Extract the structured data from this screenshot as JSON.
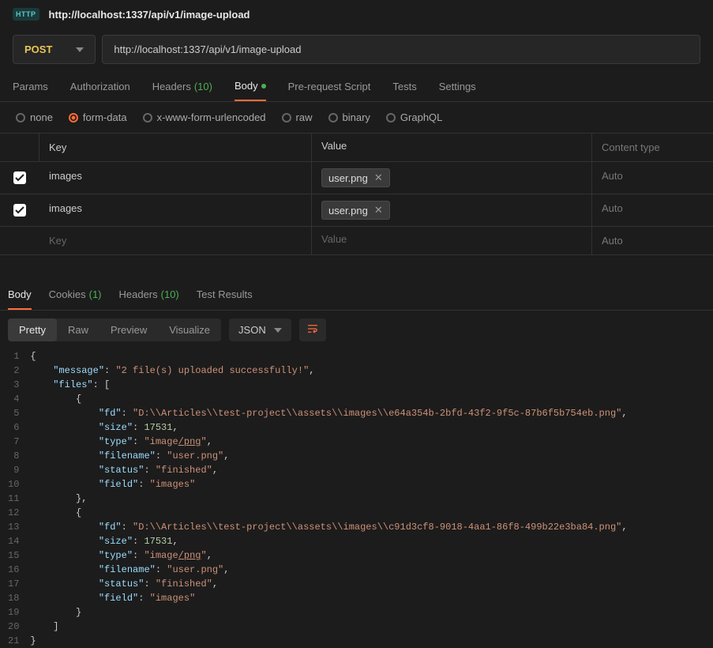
{
  "title": "http://localhost:1337/api/v1/image-upload",
  "badge": "HTTP",
  "method": "POST",
  "url": "http://localhost:1337/api/v1/image-upload",
  "request_tabs": {
    "params": "Params",
    "auth": "Authorization",
    "headers": "Headers",
    "headers_count": "(10)",
    "body": "Body",
    "prerequest": "Pre-request Script",
    "tests": "Tests",
    "settings": "Settings"
  },
  "body_types": {
    "none": "none",
    "formdata": "form-data",
    "urlencoded": "x-www-form-urlencoded",
    "raw": "raw",
    "binary": "binary",
    "graphql": "GraphQL"
  },
  "form_headers": {
    "key": "Key",
    "value": "Value",
    "type": "Content type"
  },
  "form_rows": [
    {
      "key": "images",
      "file": "user.png",
      "type": "Auto"
    },
    {
      "key": "images",
      "file": "user.png",
      "type": "Auto"
    }
  ],
  "placeholders": {
    "key": "Key",
    "value": "Value",
    "type": "Auto"
  },
  "response_tabs": {
    "body": "Body",
    "cookies": "Cookies",
    "cookies_count": "(1)",
    "headers": "Headers",
    "headers_count": "(10)",
    "tests": "Test Results"
  },
  "view_modes": {
    "pretty": "Pretty",
    "raw": "Raw",
    "preview": "Preview",
    "visualize": "Visualize"
  },
  "format": "JSON",
  "json_lines": [
    {
      "n": 1,
      "t": "{",
      "c": "p"
    },
    {
      "n": 2,
      "indent": 2,
      "parts": [
        {
          "t": "\"message\"",
          "c": "k"
        },
        {
          "t": ": ",
          "c": "p"
        },
        {
          "t": "\"2 file(s) uploaded successfully!\"",
          "c": "s"
        },
        {
          "t": ",",
          "c": "p"
        }
      ]
    },
    {
      "n": 3,
      "indent": 2,
      "parts": [
        {
          "t": "\"files\"",
          "c": "k"
        },
        {
          "t": ": [",
          "c": "p"
        }
      ]
    },
    {
      "n": 4,
      "indent": 4,
      "parts": [
        {
          "t": "{",
          "c": "p"
        }
      ]
    },
    {
      "n": 5,
      "indent": 6,
      "parts": [
        {
          "t": "\"fd\"",
          "c": "k"
        },
        {
          "t": ": ",
          "c": "p"
        },
        {
          "t": "\"D:\\\\Articles\\\\test-project\\\\assets\\\\images\\\\e64a354b-2bfd-43f2-9f5c-87b6f5b754eb.png\"",
          "c": "s"
        },
        {
          "t": ",",
          "c": "p"
        }
      ]
    },
    {
      "n": 6,
      "indent": 6,
      "parts": [
        {
          "t": "\"size\"",
          "c": "k"
        },
        {
          "t": ": ",
          "c": "p"
        },
        {
          "t": "17531",
          "c": "n"
        },
        {
          "t": ",",
          "c": "p"
        }
      ]
    },
    {
      "n": 7,
      "indent": 6,
      "parts": [
        {
          "t": "\"type\"",
          "c": "k"
        },
        {
          "t": ": ",
          "c": "p"
        },
        {
          "t": "\"image",
          "c": "s"
        },
        {
          "t": "/png",
          "c": "s u"
        },
        {
          "t": "\"",
          "c": "s"
        },
        {
          "t": ",",
          "c": "p"
        }
      ]
    },
    {
      "n": 8,
      "indent": 6,
      "parts": [
        {
          "t": "\"filename\"",
          "c": "k"
        },
        {
          "t": ": ",
          "c": "p"
        },
        {
          "t": "\"user.png\"",
          "c": "s"
        },
        {
          "t": ",",
          "c": "p"
        }
      ]
    },
    {
      "n": 9,
      "indent": 6,
      "parts": [
        {
          "t": "\"status\"",
          "c": "k"
        },
        {
          "t": ": ",
          "c": "p"
        },
        {
          "t": "\"finished\"",
          "c": "s"
        },
        {
          "t": ",",
          "c": "p"
        }
      ]
    },
    {
      "n": 10,
      "indent": 6,
      "parts": [
        {
          "t": "\"field\"",
          "c": "k"
        },
        {
          "t": ": ",
          "c": "p"
        },
        {
          "t": "\"images\"",
          "c": "s"
        }
      ]
    },
    {
      "n": 11,
      "indent": 4,
      "parts": [
        {
          "t": "},",
          "c": "p"
        }
      ]
    },
    {
      "n": 12,
      "indent": 4,
      "parts": [
        {
          "t": "{",
          "c": "p"
        }
      ]
    },
    {
      "n": 13,
      "indent": 6,
      "parts": [
        {
          "t": "\"fd\"",
          "c": "k"
        },
        {
          "t": ": ",
          "c": "p"
        },
        {
          "t": "\"D:\\\\Articles\\\\test-project\\\\assets\\\\images\\\\c91d3cf8-9018-4aa1-86f8-499b22e3ba84.png\"",
          "c": "s"
        },
        {
          "t": ",",
          "c": "p"
        }
      ]
    },
    {
      "n": 14,
      "indent": 6,
      "parts": [
        {
          "t": "\"size\"",
          "c": "k"
        },
        {
          "t": ": ",
          "c": "p"
        },
        {
          "t": "17531",
          "c": "n"
        },
        {
          "t": ",",
          "c": "p"
        }
      ]
    },
    {
      "n": 15,
      "indent": 6,
      "parts": [
        {
          "t": "\"type\"",
          "c": "k"
        },
        {
          "t": ": ",
          "c": "p"
        },
        {
          "t": "\"image",
          "c": "s"
        },
        {
          "t": "/png",
          "c": "s u"
        },
        {
          "t": "\"",
          "c": "s"
        },
        {
          "t": ",",
          "c": "p"
        }
      ]
    },
    {
      "n": 16,
      "indent": 6,
      "parts": [
        {
          "t": "\"filename\"",
          "c": "k"
        },
        {
          "t": ": ",
          "c": "p"
        },
        {
          "t": "\"user.png\"",
          "c": "s"
        },
        {
          "t": ",",
          "c": "p"
        }
      ]
    },
    {
      "n": 17,
      "indent": 6,
      "parts": [
        {
          "t": "\"status\"",
          "c": "k"
        },
        {
          "t": ": ",
          "c": "p"
        },
        {
          "t": "\"finished\"",
          "c": "s"
        },
        {
          "t": ",",
          "c": "p"
        }
      ]
    },
    {
      "n": 18,
      "indent": 6,
      "parts": [
        {
          "t": "\"field\"",
          "c": "k"
        },
        {
          "t": ": ",
          "c": "p"
        },
        {
          "t": "\"images\"",
          "c": "s"
        }
      ]
    },
    {
      "n": 19,
      "indent": 4,
      "parts": [
        {
          "t": "}",
          "c": "p"
        }
      ]
    },
    {
      "n": 20,
      "indent": 2,
      "parts": [
        {
          "t": "]",
          "c": "p"
        }
      ]
    },
    {
      "n": 21,
      "t": "}",
      "c": "p"
    }
  ]
}
